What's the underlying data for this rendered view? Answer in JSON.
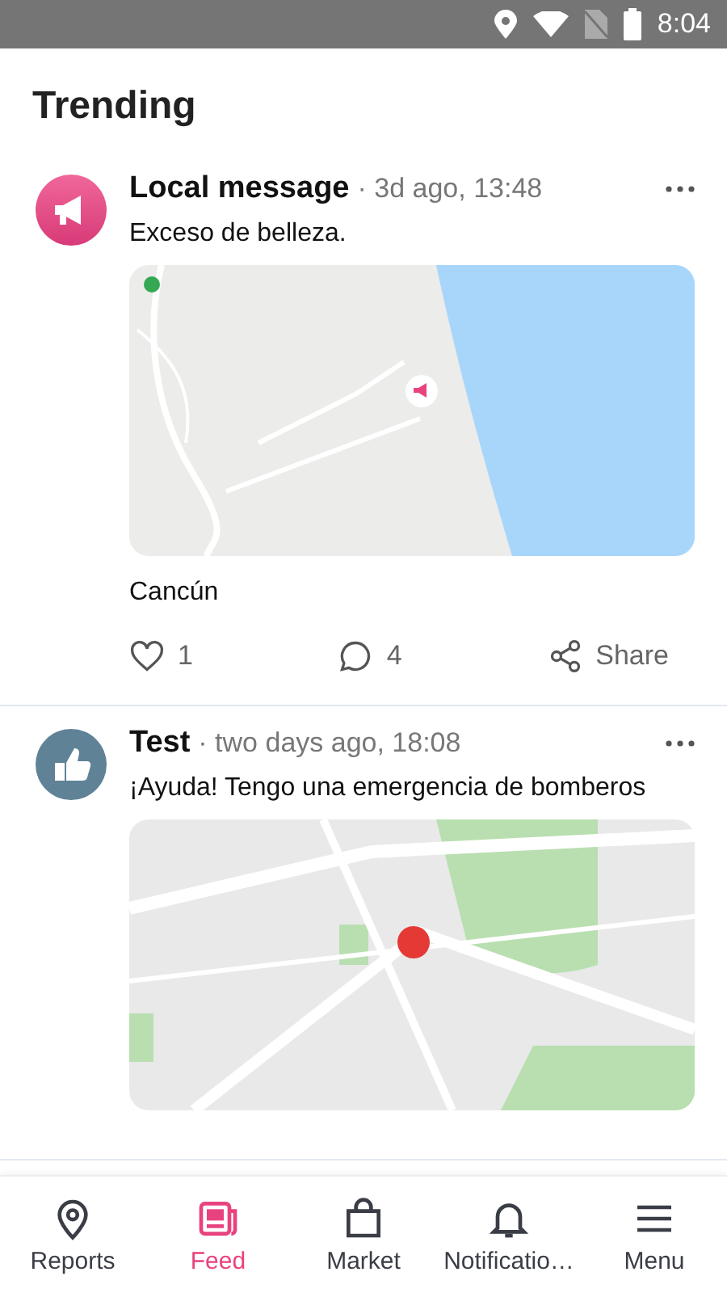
{
  "status_bar": {
    "time": "8:04"
  },
  "header": {
    "title": "Trending"
  },
  "posts": [
    {
      "kind": "announcement",
      "author": "Local message",
      "time": "· 3d ago, 13:48",
      "text": "Exceso de belleza.",
      "place": "Cancún",
      "likes": "1",
      "comments": "4",
      "share": "Share"
    },
    {
      "kind": "thumbs",
      "author": "Test",
      "time": "· two days ago, 18:08",
      "text": "¡Ayuda! Tengo una emergencia de bomberos"
    }
  ],
  "nav": [
    {
      "label": "Reports",
      "selected": false
    },
    {
      "label": "Feed",
      "selected": true
    },
    {
      "label": "Market",
      "selected": false
    },
    {
      "label": "Notificatio…",
      "selected": false
    },
    {
      "label": "Menu",
      "selected": false
    }
  ]
}
